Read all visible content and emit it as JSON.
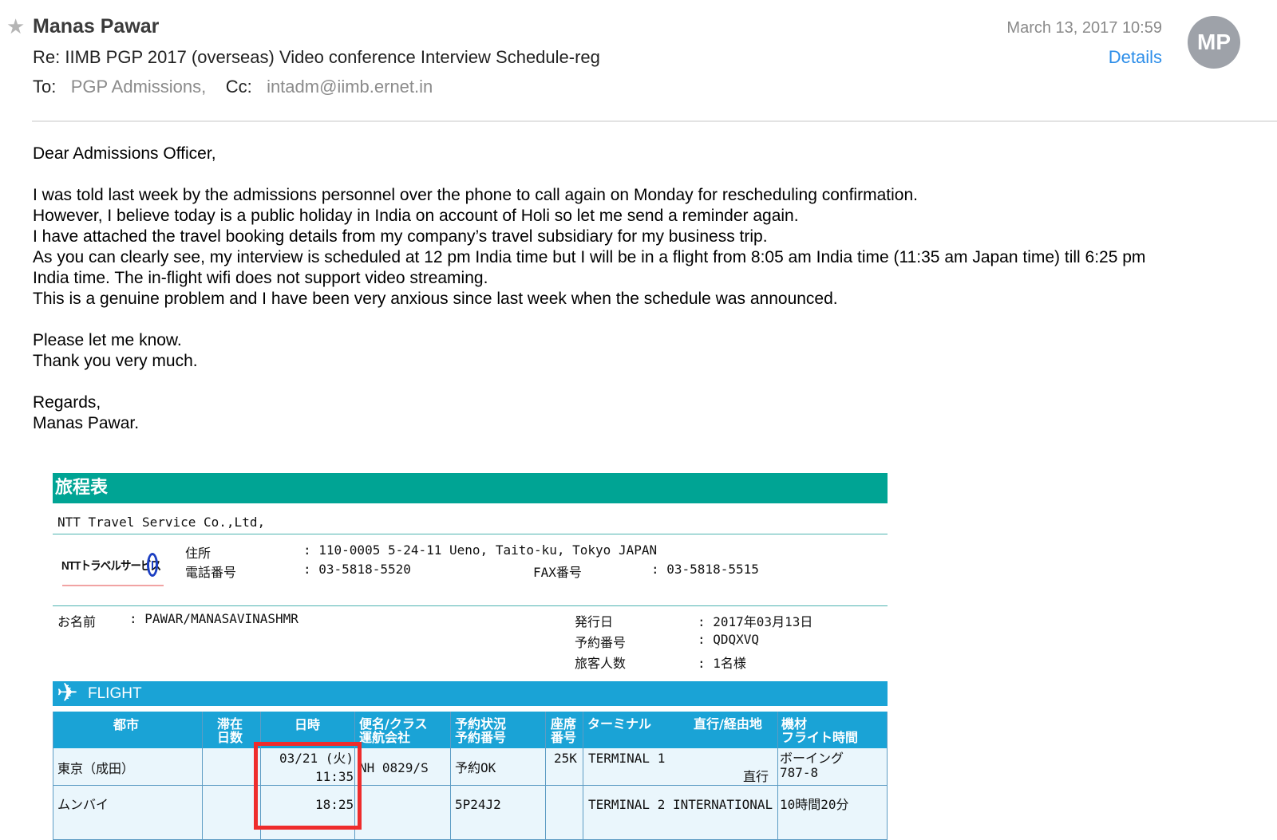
{
  "header": {
    "star_icon": "star-icon",
    "sender": "Manas Pawar",
    "subject": "Re: IIMB PGP 2017 (overseas) Video conference Interview Schedule-reg",
    "to_label": "To:",
    "to_value": "PGP Admissions,",
    "cc_label": "Cc:",
    "cc_value": "intadm@iimb.ernet.in",
    "date": "March 13, 2017 10:59",
    "details_link": "Details",
    "avatar_initials": "MP"
  },
  "body": {
    "greeting": "Dear Admissions Officer,",
    "para1": [
      "I was told last week by the admissions personnel over the phone to call again on Monday for rescheduling confirmation.",
      "However, I believe today is a public holiday in India on account of Holi so let me send a reminder again.",
      "I have attached the travel booking details from my company’s travel subsidiary for my business trip.",
      "As you can clearly see, my interview is scheduled at 12 pm India time but I will be in a flight from 8:05 am India time (11:35 am Japan time) till 6:25 pm",
      "India time. The in-flight wifi does not support video streaming.",
      "This is a genuine problem and I have been very anxious since last week when the schedule was announced."
    ],
    "para2": [
      "Please let me know.",
      "Thank you very much."
    ],
    "closing": [
      "Regards,",
      "Manas Pawar."
    ]
  },
  "itinerary": {
    "banner_title": "旅程表",
    "company": "NTT Travel  Service Co.,Ltd,",
    "logo_text": "NTTトラベルサービス",
    "address_label": "住所",
    "address_value": ":  110-0005 5-24-11 Ueno, Taito-ku, Tokyo JAPAN",
    "phone_label": "電話番号",
    "phone_value": ":  03-5818-5520",
    "fax_label": "FAX番号",
    "fax_value": ":  03-5818-5515",
    "name_label": "お名前",
    "name_value": ":  PAWAR/MANASAVINASHMR",
    "issue_label": "発行日",
    "issue_value": ":  2017年03月13日",
    "booking_label": "予約番号",
    "booking_value": ":  QDQXVQ",
    "pax_label": "旅客人数",
    "pax_value": ":  1名様",
    "flight_banner": "FLIGHT",
    "columns": {
      "city": "都市",
      "stay": [
        "滞在",
        "日数"
      ],
      "datetime": "日時",
      "flight": [
        "便名/クラス",
        "運航会社"
      ],
      "status": [
        "予約状況",
        "予約番号"
      ],
      "seat": [
        "座席",
        "番号"
      ],
      "terminal": "ターミナル",
      "route": "直行/経由地",
      "aircraft": [
        "機材",
        "フライト時間"
      ]
    },
    "rows": {
      "dep_city": "東京（成田）",
      "date": "03/21 (火)",
      "dep_time": "11:35",
      "flight_no": "NH 0829/S",
      "status": "予約OK",
      "seat": "25K",
      "dep_terminal": "TERMINAL 1",
      "route": "直行",
      "aircraft": [
        "ボーイング",
        "787-8"
      ],
      "arr_city": "ムンバイ",
      "arr_time": "18:25",
      "pnr": "5P24J2",
      "arr_terminal": "TERMINAL 2 INTERNATIONAL",
      "duration": "10時間20分"
    }
  }
}
